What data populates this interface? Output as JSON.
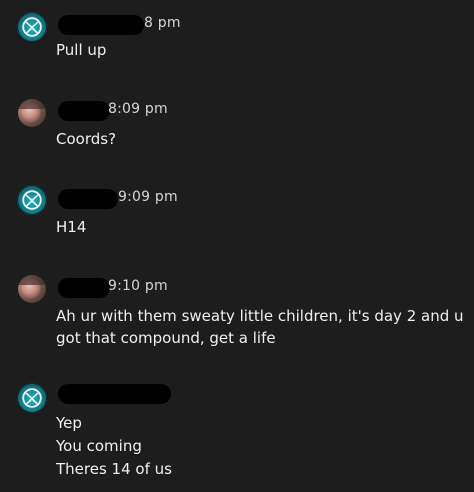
{
  "messages": [
    {
      "sender": "xbox",
      "time": "8 pm",
      "lines": [
        "Pull up"
      ]
    },
    {
      "sender": "person",
      "time": "8:09 pm",
      "lines": [
        "Coords?"
      ]
    },
    {
      "sender": "xbox",
      "time": "9:09 pm",
      "lines": [
        "H14"
      ]
    },
    {
      "sender": "person",
      "time": "9:10 pm",
      "lines": [
        "Ah ur with them sweaty little children, it's day 2 and u",
        "got that compound, get a life"
      ]
    },
    {
      "sender": "xbox",
      "time": "",
      "lines": [
        "Yep",
        "You coming",
        "Theres 14 of us"
      ]
    }
  ]
}
